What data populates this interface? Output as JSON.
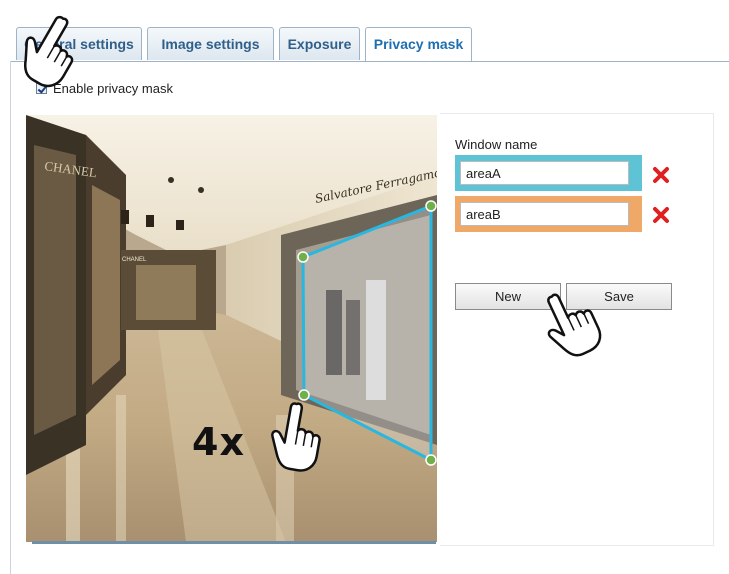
{
  "tabs": [
    {
      "label": "General settings",
      "active": false
    },
    {
      "label": "Image settings",
      "active": false
    },
    {
      "label": "Exposure",
      "active": false
    },
    {
      "label": "Privacy mask",
      "active": true
    }
  ],
  "enable_privacy_mask": {
    "label": "Enable privacy mask",
    "checked": true
  },
  "window_list": {
    "title": "Window name",
    "windows": [
      {
        "name": "areaA",
        "color": "#5fc3d6"
      },
      {
        "name": "areaB",
        "color": "#f0a868"
      }
    ],
    "delete_icon": "red-x-icon"
  },
  "buttons": {
    "new_label": "New",
    "save_label": "Save"
  },
  "annotation": {
    "multiplier_text": "4x"
  },
  "video_storefront": {
    "brand_text": "Salvatore Ferragamo",
    "store_sign": "CHANEL"
  },
  "colors": {
    "mask_outline": "#29b7e0",
    "handle": "#6fb04a",
    "delete": "#e02020",
    "tab_text": "#2f5f8a"
  }
}
